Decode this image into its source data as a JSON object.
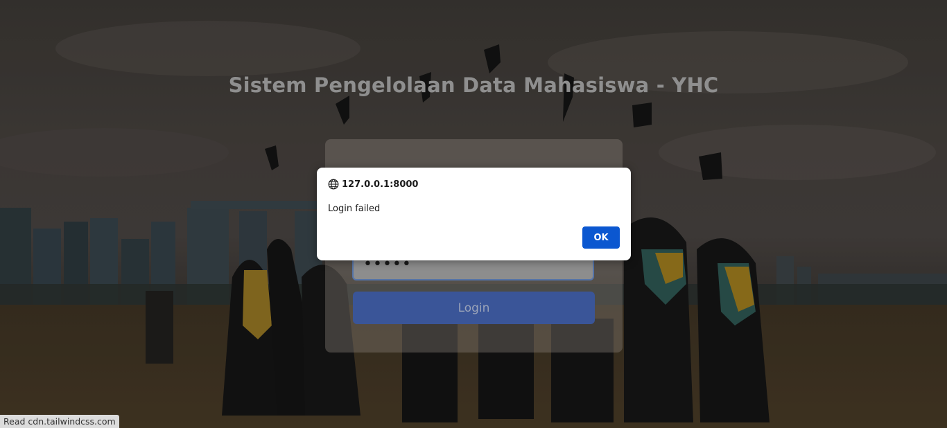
{
  "page": {
    "title": "Sistem Pengelolaan Data Mahasiswa - YHC"
  },
  "login_form": {
    "password_value": "•••••",
    "login_button_label": "Login"
  },
  "alert_dialog": {
    "origin": "127.0.0.1:8000",
    "origin_icon": "globe-icon",
    "message": "Login failed",
    "ok_label": "OK"
  },
  "status_bar": {
    "text": "Read cdn.tailwindcss.com"
  },
  "colors": {
    "primary_button": "#0b57d0",
    "login_button": "#3a5598"
  }
}
